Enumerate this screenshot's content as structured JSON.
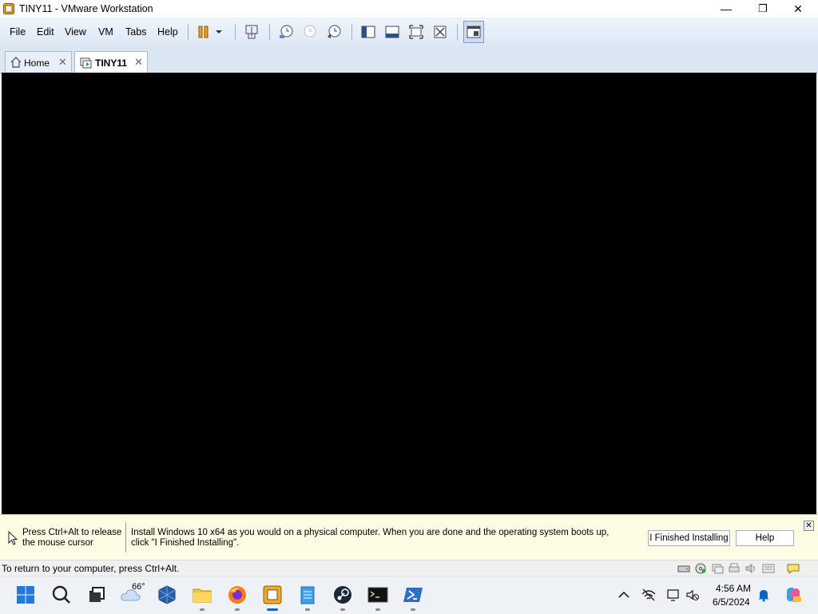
{
  "window": {
    "title": "TINY11 - VMware Workstation",
    "minimize": "—",
    "maximize": "❐",
    "close": "✕"
  },
  "menu": [
    "File",
    "Edit",
    "View",
    "VM",
    "Tabs",
    "Help"
  ],
  "tabs": [
    {
      "label": "Home",
      "close": "✕"
    },
    {
      "label": "TINY11",
      "close": "✕"
    }
  ],
  "hint": {
    "release_text": "Press Ctrl+Alt to release the mouse cursor",
    "install_text": "Install Windows 10 x64 as you would on a physical computer. When you are done and the operating system boots up, click \"I Finished Installing\".",
    "finished_button": "I Finished Installing",
    "help_button": "Help",
    "close": "✕"
  },
  "status": {
    "text": "To return to your computer, press Ctrl+Alt."
  },
  "taskbar": {
    "weather_temp": "66°",
    "time": "4:56 AM",
    "date": "6/5/2024"
  },
  "colors": {
    "accent": "#0067c0",
    "toolbar_bg": "#dde8f5",
    "hint_bg": "#fdfde6",
    "vm_screen": "#000000"
  }
}
